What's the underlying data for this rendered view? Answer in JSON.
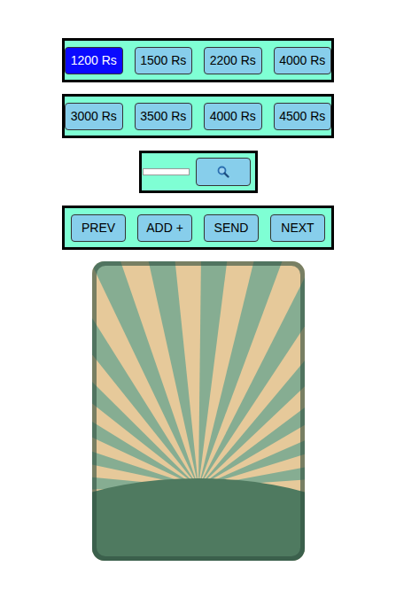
{
  "price_rows": [
    [
      {
        "label": "1200 Rs",
        "selected": true
      },
      {
        "label": "1500 Rs",
        "selected": false
      },
      {
        "label": "2200 Rs",
        "selected": false
      },
      {
        "label": "4000 Rs",
        "selected": false
      }
    ],
    [
      {
        "label": "3000 Rs",
        "selected": false
      },
      {
        "label": "3500 Rs",
        "selected": false
      },
      {
        "label": "4000 Rs",
        "selected": false
      },
      {
        "label": "4500 Rs",
        "selected": false
      }
    ]
  ],
  "search": {
    "value": ""
  },
  "actions": [
    "PREV",
    "ADD +",
    "SEND",
    "NEXT"
  ]
}
